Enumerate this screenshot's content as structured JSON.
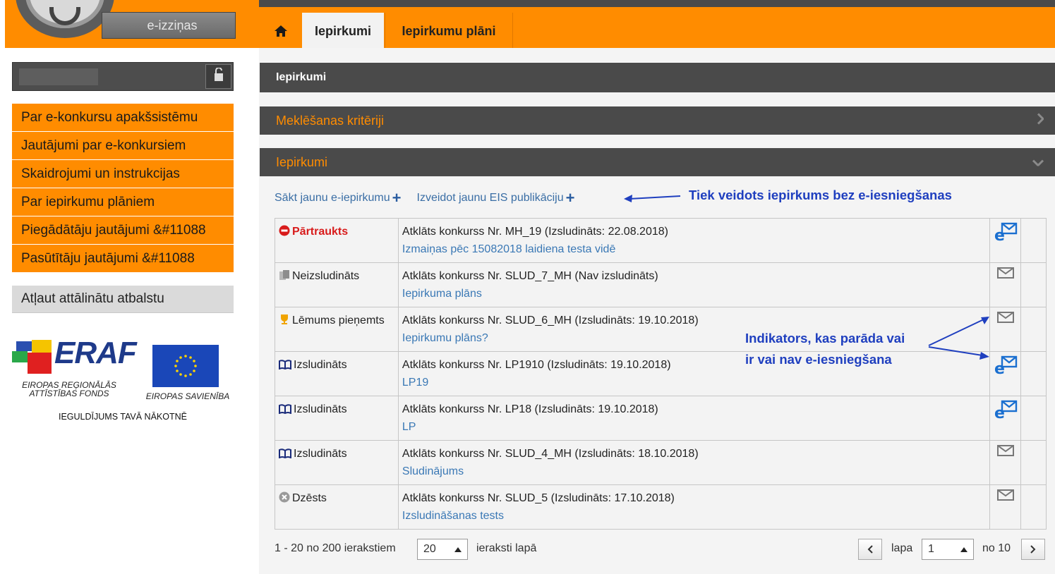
{
  "header": {
    "izzinas_label": "e-izziņas",
    "tabs": [
      {
        "label": "Iepirkumi",
        "active": true
      },
      {
        "label": "Iepirkumu plāni",
        "active": false
      }
    ]
  },
  "sidebar": {
    "items": [
      {
        "label": "Par e-konkursu apakšsistēmu"
      },
      {
        "label": "Jautājumi par e-konkursiem"
      },
      {
        "label": "Skaidrojumi un instrukcijas"
      },
      {
        "label": "Par iepirkumu plāniem"
      },
      {
        "label": "Piegādātāju jautājumi &#11088"
      },
      {
        "label": "Pasūtītāju jautājumi &#11088"
      }
    ],
    "remote_support": "Atļaut attālinātu atbalstu"
  },
  "logos": {
    "eraf": "ERAF",
    "eraf_sub_line1": "EIROPAS REĢIONĀLĀS",
    "eraf_sub_line2": "ATTĪSTĪBAS FONDS",
    "eu_sub": "EIROPAS SAVIENĪBA",
    "invest": "IEGULDĪJUMS TAVĀ NĀKOTNĒ"
  },
  "main": {
    "section_title": "Iepirkumi",
    "criteria_title": "Meklēšanas kritēriji",
    "list_title": "Iepirkumi",
    "actions": {
      "start_new": "Sākt jaunu e-iepirkumu",
      "create_eis": "Izveidot jaunu EIS publikāciju"
    },
    "annotation_top": "Tiek veidots iepirkums bez e-iesniegšanas",
    "annotation_mid_line1": "Indikators, kas parāda vai",
    "annotation_mid_line2": "ir vai nav e-iesniegšana",
    "rows": [
      {
        "status": "Pārtraukts",
        "status_icon": "stop-icon",
        "title": "Atklāts konkurss Nr. MH_19 (Izsludināts: 22.08.2018)",
        "link": "Izmaiņas pēc 15082018 laidiena testa vidē",
        "e_submission": true
      },
      {
        "status": "Neizsludināts",
        "status_icon": "documents-icon",
        "title": "Atklāts konkurss Nr. SLUD_7_MH (Nav izsludināts)",
        "link": "Iepirkuma plāns",
        "e_submission": false
      },
      {
        "status": "Lēmums pieņemts",
        "status_icon": "trophy-icon",
        "title": "Atklāts konkurss Nr. SLUD_6_MH (Izsludināts: 19.10.2018)",
        "link": "Iepirkumu plāns?",
        "e_submission": false
      },
      {
        "status": "Izsludināts",
        "status_icon": "book-icon",
        "title": "Atklāts konkurss Nr. LP1910 (Izsludināts: 19.10.2018)",
        "link": "LP19",
        "e_submission": true
      },
      {
        "status": "Izsludināts",
        "status_icon": "book-icon",
        "title": "Atklāts konkurss Nr. LP18 (Izsludināts: 19.10.2018)",
        "link": "LP",
        "e_submission": true
      },
      {
        "status": "Izsludināts",
        "status_icon": "book-icon",
        "title": "Atklāts konkurss Nr. SLUD_4_MH (Izsludināts: 18.10.2018)",
        "link": "Sludinājums",
        "e_submission": false
      },
      {
        "status": "Dzēsts",
        "status_icon": "deleted-icon",
        "title": "Atklāts konkurss Nr. SLUD_5 (Izsludināts: 17.10.2018)",
        "link": "Izsludināšanas tests",
        "e_submission": false
      }
    ],
    "pager": {
      "count_text": "1 - 20 no 200 ierakstiem",
      "page_size": "20",
      "per_page_text": "ieraksti lapā",
      "page_label": "lapa",
      "page_value": "1",
      "of_text": "no 10"
    }
  },
  "colors": {
    "accent": "#ff8c00",
    "dark": "#4a4a4a",
    "link": "#3a78b5",
    "annotation": "#1f3fbf"
  }
}
